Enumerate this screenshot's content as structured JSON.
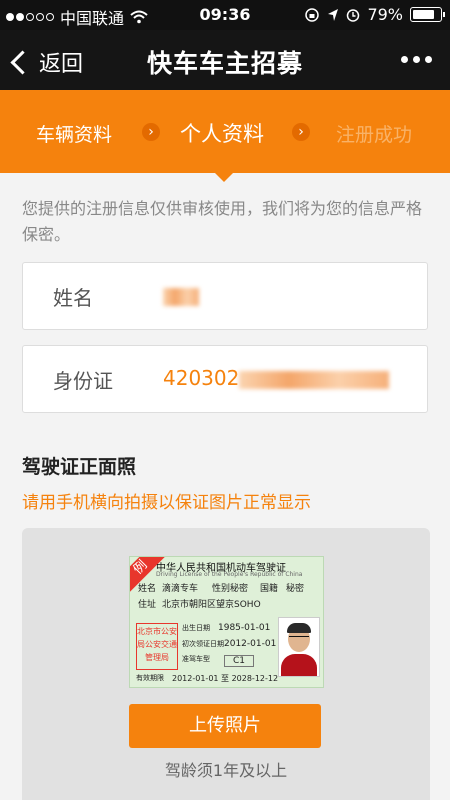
{
  "status_bar": {
    "carrier": "中国联通",
    "time": "09:36",
    "battery": "79%",
    "battery_level": 0.79
  },
  "nav": {
    "back_label": "返回",
    "title": "快车车主招募"
  },
  "steps": {
    "step1": "车辆资料",
    "step2": "个人资料",
    "step3": "注册成功",
    "separator": "›"
  },
  "notice": "您提供的注册信息仅供审核使用，我们将为您的信息严格保密。",
  "form": {
    "name_label": "姓名",
    "id_label": "身份证",
    "id_value_visible": "420302"
  },
  "license_section": {
    "title": "驾驶证正面照",
    "tip": "请用手机横向拍摄以保证图片正常显示",
    "sample": {
      "ribbon": "例",
      "heading": "中华人民共和国机动车驾驶证",
      "heading_en": "Driving License of the People's Republic of China",
      "name_label": "姓名",
      "name_value": "滴滴专车",
      "sex_label": "性别",
      "sex_value": "秘密",
      "nationality_label": "国籍",
      "nationality_value": "秘密",
      "address_label": "住址",
      "address_value": "北京市朝阳区望京SOHO",
      "birth_label": "出生日期",
      "birth_value": "1985-01-01",
      "issue_label": "初次领证日期",
      "issue_value": "2012-01-01",
      "class_label": "准驾车型",
      "class_value": "C1",
      "valid_label": "有效期限",
      "valid_value": "2012-01-01 至 2028-12-12",
      "stamp": "北京市公安局公安交通管理局"
    },
    "upload_button": "上传照片",
    "upload_tip": "驾龄须1年及以上"
  }
}
